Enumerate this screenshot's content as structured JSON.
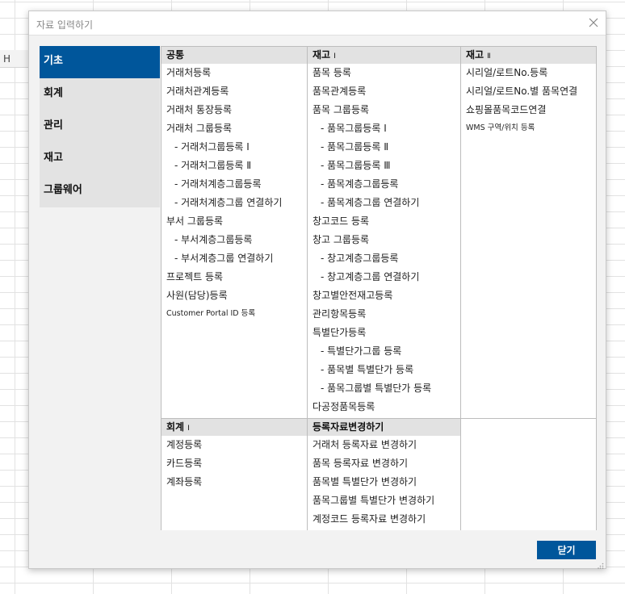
{
  "background": {
    "column_letter": "H"
  },
  "dialog": {
    "title": "자료 입력하기",
    "close_label": "닫기"
  },
  "nav": {
    "items": [
      {
        "label": "기초",
        "active": true
      },
      {
        "label": "회계",
        "active": false
      },
      {
        "label": "관리",
        "active": false
      },
      {
        "label": "재고",
        "active": false
      },
      {
        "label": "그룹웨어",
        "active": false
      }
    ]
  },
  "sections": {
    "common": {
      "title": "공통",
      "items": [
        "거래처등록",
        "거래처관계등록",
        "거래처 통장등록",
        "거래처 그룹등록",
        "- 거래처그룹등록 Ⅰ",
        "- 거래처그룹등록 Ⅱ",
        "- 거래처계층그룹등록",
        "- 거래처계층그룹 연결하기",
        "부서 그룹등록",
        "- 부서계층그룹등록",
        "- 부서계층그룹 연결하기",
        "프로젝트 등록",
        "사원(담당)등록",
        "Customer Portal ID 등록"
      ]
    },
    "inventory1": {
      "title": "재고",
      "roman": "Ⅰ",
      "items": [
        "품목 등록",
        "품목관계등록",
        "품목 그룹등록",
        "- 품목그룹등록 Ⅰ",
        "- 품목그룹등록 Ⅱ",
        "- 품목그룹등록 Ⅲ",
        "- 품목계층그룹등록",
        "- 품목계층그룹 연결하기",
        "창고코드 등록",
        "창고 그룹등록",
        "- 창고계층그룹등록",
        "- 창고계층그룹 연결하기",
        "창고별안전재고등록",
        "관리항목등록",
        "특별단가등록",
        "- 특별단가그룹 등록",
        "- 품목별 특별단가 등록",
        "- 품목그룹별 특별단가 등록",
        "다공정품목등록"
      ]
    },
    "inventory2": {
      "title": "재고",
      "roman": "Ⅱ",
      "items": [
        "시리얼/로트No.등록",
        "시리얼/로트No.별 품목연결",
        "쇼핑몰품목코드연결",
        "WMS 구역/위치 등록"
      ]
    },
    "accounting1": {
      "title": "회계",
      "roman": "Ⅰ",
      "items": [
        "계정등록",
        "카드등록",
        "계좌등록"
      ]
    },
    "change": {
      "title": "등록자료변경하기",
      "items": [
        "거래처 등록자료 변경하기",
        "품목 등록자료 변경하기",
        "품목별 특별단가 변경하기",
        "품목그룹별 특별단가 변경하기",
        "계정코드 등록자료 변경하기"
      ]
    }
  },
  "colors": {
    "accent": "#00569b",
    "header_bg": "#e2e2e2",
    "nav_bg": "#e3e3e3"
  }
}
